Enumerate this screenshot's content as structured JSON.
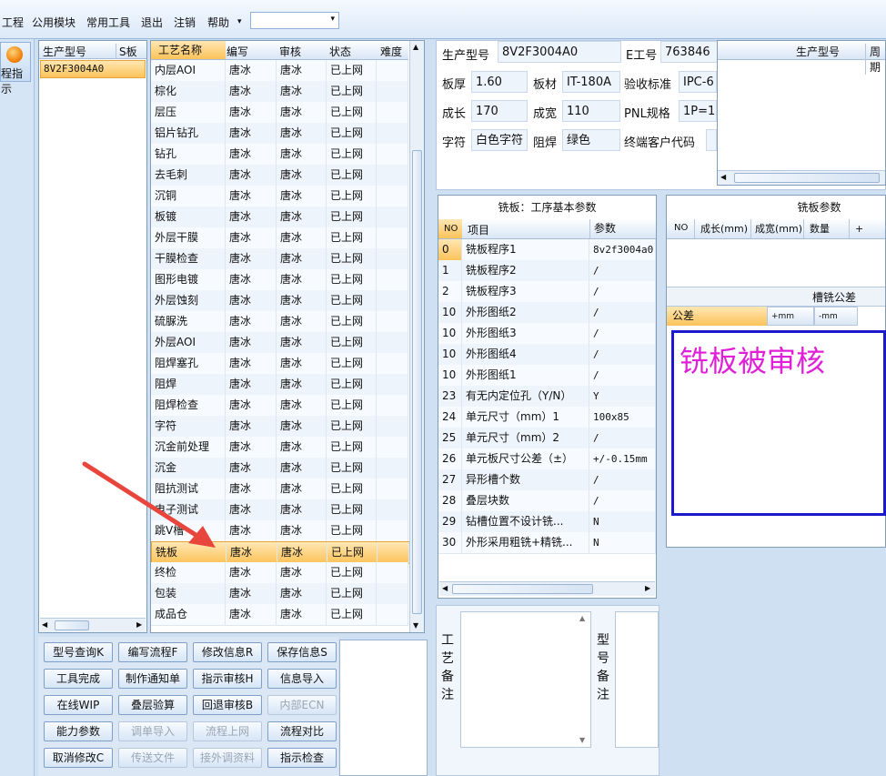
{
  "menu": {
    "items": [
      "工程",
      "公用模块",
      "常用工具",
      "退出",
      "注销",
      "帮助"
    ],
    "help_arrow": "▾",
    "dropdown_arrow": "▾"
  },
  "left_button": {
    "label": "程指示"
  },
  "model_list": {
    "headers": [
      "生产型号",
      "S板"
    ],
    "rows": [
      [
        "8V2F3004A0",
        ""
      ]
    ]
  },
  "process_grid": {
    "headers": [
      "工艺名称",
      "编写",
      "审核",
      "状态",
      "难度"
    ],
    "selected_index": 23,
    "rows": [
      [
        "内层AOI",
        "唐冰",
        "唐冰",
        "已上网",
        ""
      ],
      [
        "棕化",
        "唐冰",
        "唐冰",
        "已上网",
        ""
      ],
      [
        "层压",
        "唐冰",
        "唐冰",
        "已上网",
        ""
      ],
      [
        "铝片钻孔",
        "唐冰",
        "唐冰",
        "已上网",
        ""
      ],
      [
        "钻孔",
        "唐冰",
        "唐冰",
        "已上网",
        ""
      ],
      [
        "去毛刺",
        "唐冰",
        "唐冰",
        "已上网",
        ""
      ],
      [
        "沉铜",
        "唐冰",
        "唐冰",
        "已上网",
        ""
      ],
      [
        "板镀",
        "唐冰",
        "唐冰",
        "已上网",
        ""
      ],
      [
        "外层干膜",
        "唐冰",
        "唐冰",
        "已上网",
        ""
      ],
      [
        "干膜检查",
        "唐冰",
        "唐冰",
        "已上网",
        ""
      ],
      [
        "图形电镀",
        "唐冰",
        "唐冰",
        "已上网",
        ""
      ],
      [
        "外层蚀刻",
        "唐冰",
        "唐冰",
        "已上网",
        ""
      ],
      [
        "硫脲洗",
        "唐冰",
        "唐冰",
        "已上网",
        ""
      ],
      [
        "外层AOI",
        "唐冰",
        "唐冰",
        "已上网",
        ""
      ],
      [
        "阻焊塞孔",
        "唐冰",
        "唐冰",
        "已上网",
        ""
      ],
      [
        "阻焊",
        "唐冰",
        "唐冰",
        "已上网",
        ""
      ],
      [
        "阻焊检查",
        "唐冰",
        "唐冰",
        "已上网",
        ""
      ],
      [
        "字符",
        "唐冰",
        "唐冰",
        "已上网",
        ""
      ],
      [
        "沉金前处理",
        "唐冰",
        "唐冰",
        "已上网",
        ""
      ],
      [
        "沉金",
        "唐冰",
        "唐冰",
        "已上网",
        ""
      ],
      [
        "阻抗测试",
        "唐冰",
        "唐冰",
        "已上网",
        ""
      ],
      [
        "电子测试",
        "唐冰",
        "唐冰",
        "已上网",
        ""
      ],
      [
        "跳V槽",
        "唐冰",
        "唐冰",
        "已上网",
        ""
      ],
      [
        "铣板",
        "唐冰",
        "唐冰",
        "已上网",
        ""
      ],
      [
        "终检",
        "唐冰",
        "唐冰",
        "已上网",
        ""
      ],
      [
        "包装",
        "唐冰",
        "唐冰",
        "已上网",
        ""
      ],
      [
        "成品仓",
        "唐冰",
        "唐冰",
        "已上网",
        ""
      ]
    ]
  },
  "buttons": [
    [
      "型号查询K",
      "编写流程F",
      "修改信息R",
      "保存信息S"
    ],
    [
      "工具完成",
      "制作通知单",
      "指示审核H",
      "信息导入"
    ],
    [
      "在线WIP",
      "叠层验算",
      "回退审核B",
      "内部ECN"
    ],
    [
      "能力参数",
      "调单导入",
      "流程上网",
      "流程对比"
    ],
    [
      "取消修改C",
      "传送文件",
      "接外调资料",
      "指示检查"
    ]
  ],
  "disabled_buttons": [
    "内部ECN",
    "调单导入",
    "流程上网",
    "传送文件",
    "接外调资料"
  ],
  "info": {
    "model_label": "生产型号",
    "model_value": "8V2F3004A0",
    "eno_label": "E工号",
    "eno_value": "763846",
    "thick_label": "板厚",
    "thick_value": "1.60",
    "material_label": "板材",
    "material_value": "IT-180A",
    "standard_label": "验收标准",
    "standard_value": "IPC-6",
    "len_label": "成长",
    "len_value": "170",
    "width_label": "成宽",
    "width_value": "110",
    "pnl_label": "PNL规格",
    "pnl_value": "1P=1(",
    "char_label": "字符",
    "char_value": "白色字符",
    "mask_label": "阻焊",
    "mask_value": "绿色",
    "customer_label": "终端客户代码",
    "customer_value": ""
  },
  "mini_grid": {
    "headers": [
      "生产型号",
      "周期"
    ]
  },
  "params_grid": {
    "title": "铣板：工序基本参数",
    "headers": [
      "NO",
      "项目",
      "参数"
    ],
    "rows": [
      [
        "0",
        "铣板程序1",
        "8v2f3004a0"
      ],
      [
        "1",
        "铣板程序2",
        "/"
      ],
      [
        "2",
        "铣板程序3",
        "/"
      ],
      [
        "10",
        "外形图纸2",
        "/"
      ],
      [
        "10",
        "外形图纸3",
        "/"
      ],
      [
        "10",
        "外形图纸4",
        "/"
      ],
      [
        "10",
        "外形图纸1",
        "/"
      ],
      [
        "23",
        "有无内定位孔（Y/N）",
        "Y"
      ],
      [
        "24",
        "单元尺寸（mm）1",
        "100x85"
      ],
      [
        "25",
        "单元尺寸（mm）2",
        "/"
      ],
      [
        "26",
        "单元板尺寸公差（±）",
        "+/-0.15mm"
      ],
      [
        "27",
        "异形槽个数",
        "/"
      ],
      [
        "28",
        "叠层块数",
        "/"
      ],
      [
        "29",
        "钻槽位置不设计铣...",
        "N"
      ],
      [
        "30",
        "外形采用粗铣+精铣...",
        "N"
      ]
    ]
  },
  "mill_params": {
    "title": "铣板参数",
    "headers": [
      "NO",
      "成长(mm)",
      "成宽(mm)",
      "数量",
      "+"
    ]
  },
  "slot_tolerance": {
    "title": "槽铣公差",
    "headers": [
      "公差",
      "+mm",
      "-mm"
    ]
  },
  "review_text": "铣板被审核",
  "remarks": {
    "process_label": "工艺备注",
    "model_label": "型号备注"
  },
  "colors": {
    "review_text": "#e020d8",
    "review_border": "#1a1acc",
    "accent": "#f07a00"
  }
}
